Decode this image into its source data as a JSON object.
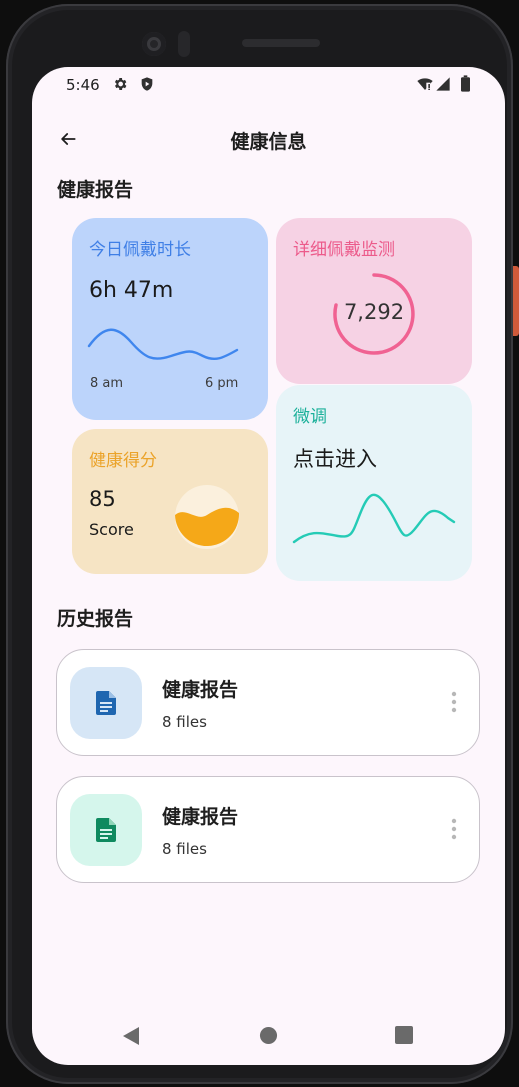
{
  "status_bar": {
    "time": "5:46"
  },
  "app_bar": {
    "title": "健康信息"
  },
  "section_report": "健康报告",
  "cards": {
    "wear_today": {
      "title": "今日佩戴时长",
      "value": "6h 47m",
      "start_label": "8 am",
      "end_label": "6 pm",
      "color": "#3f7fe6"
    },
    "wear_detail": {
      "title": "详细佩戴监测",
      "value": "7,292",
      "color": "#ec5b8b"
    },
    "health_score": {
      "title": "健康得分",
      "value": "85",
      "unit": "Score",
      "color": "#eba32a"
    },
    "fine_tune": {
      "title": "微调",
      "action": "点击进入",
      "color": "#1bb09a"
    }
  },
  "section_history": "历史报告",
  "history": [
    {
      "name": "健康报告",
      "count": "8 files",
      "icon": "document-icon",
      "color": "#1f66b0"
    },
    {
      "name": "健康报告",
      "count": "8 files",
      "icon": "sheet-icon",
      "color": "#0f8a5f"
    }
  ],
  "icons": [
    "gear-icon",
    "shield-icon",
    "wifi-icon",
    "signal-icon",
    "battery-icon",
    "back-arrow-icon",
    "more-vert-icon",
    "nav-back-icon",
    "nav-home-icon",
    "nav-recents-icon"
  ]
}
